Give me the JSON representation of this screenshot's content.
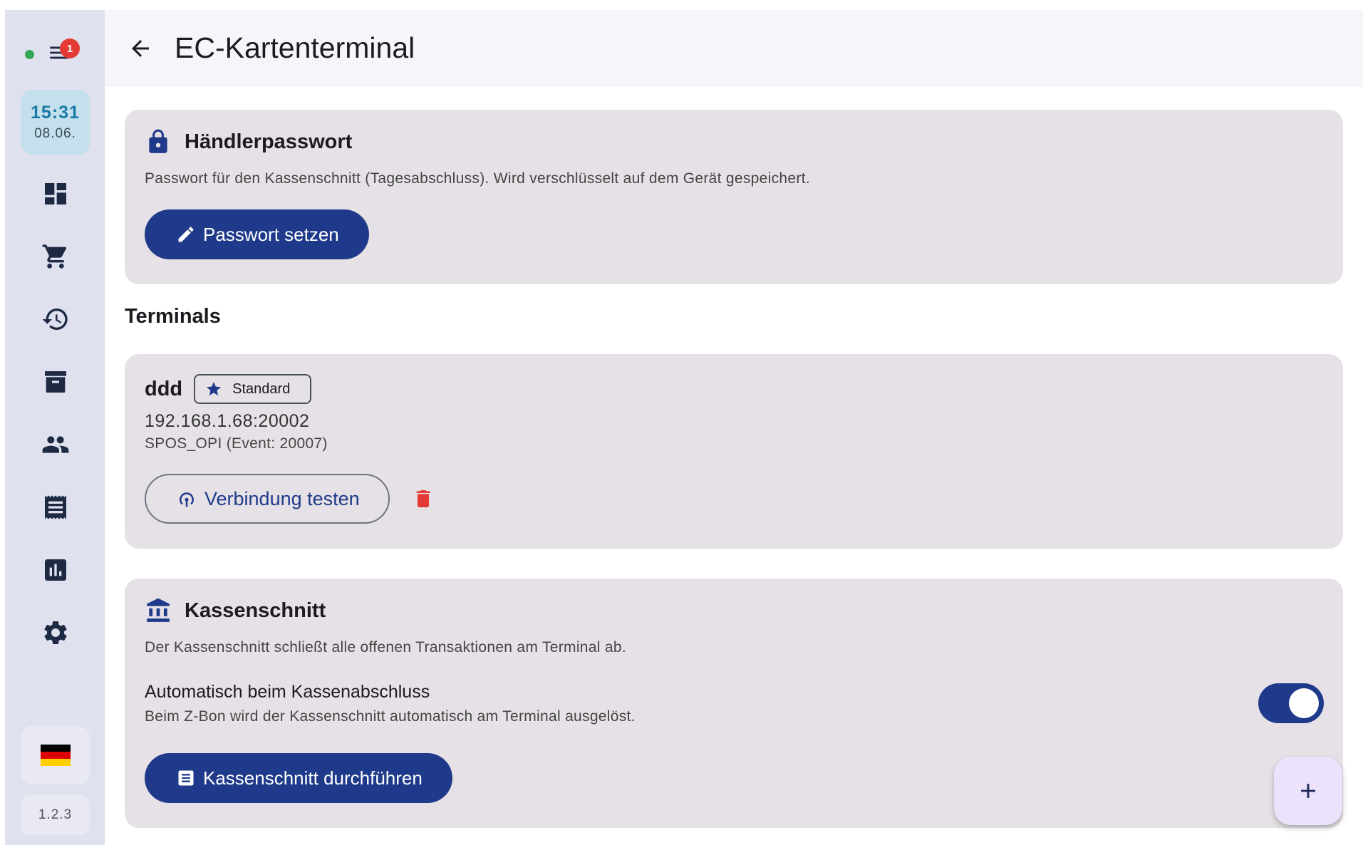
{
  "sidebar": {
    "notification_count": "1",
    "clock": {
      "time": "15:31",
      "date": "08.06."
    },
    "nav_items": [
      {
        "icon": "dashboard-icon"
      },
      {
        "icon": "cart-icon"
      },
      {
        "icon": "history-icon"
      },
      {
        "icon": "archive-icon"
      },
      {
        "icon": "people-icon"
      },
      {
        "icon": "receipt-icon"
      },
      {
        "icon": "chart-icon"
      },
      {
        "icon": "settings-icon"
      }
    ],
    "language": "de",
    "version": "1.2.3"
  },
  "header": {
    "title": "EC-Kartenterminal"
  },
  "merchant_password": {
    "title": "Händlerpasswort",
    "description": "Passwort für den Kassenschnitt (Tagesabschluss). Wird verschlüsselt auf dem Gerät gespeichert.",
    "button_label": "Passwort setzen"
  },
  "terminals": {
    "section_label": "Terminals",
    "items": [
      {
        "name": "ddd",
        "badge": "Standard",
        "address": "192.168.1.68:20002",
        "protocol": "SPOS_OPI (Event: 20007)",
        "test_button_label": "Verbindung testen"
      }
    ]
  },
  "settlement": {
    "title": "Kassenschnitt",
    "description": "Der Kassenschnitt schließt alle offenen Transaktionen am Terminal ab.",
    "auto_setting": {
      "title": "Automatisch beim Kassenabschluss",
      "subtitle": "Beim Z-Bon wird der Kassenschnitt automatisch am Terminal ausgelöst.",
      "enabled": true
    },
    "button_label": "Kassenschnitt durchführen"
  },
  "colors": {
    "primary": "#1f3a8a",
    "card_bg": "#e6e1e6",
    "sidebar_bg": "#dfe1ef",
    "danger": "#e53935",
    "status_online": "#34a853"
  }
}
